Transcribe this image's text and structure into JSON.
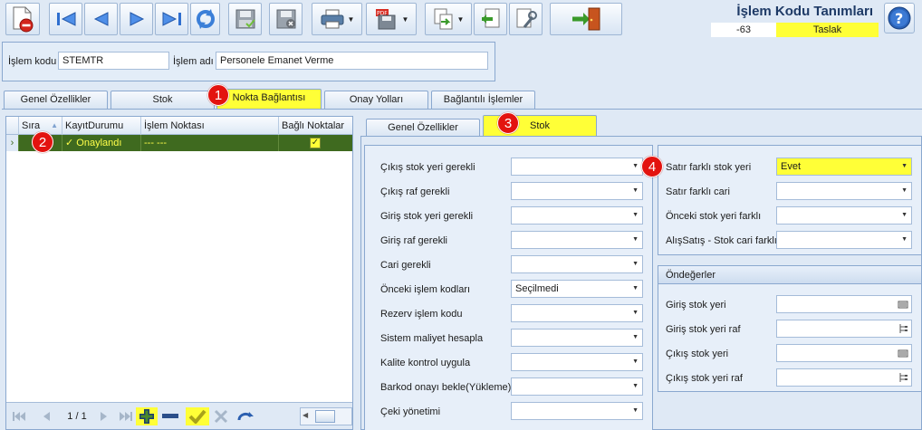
{
  "header": {
    "title": "İşlem Kodu Tanımları",
    "record_no": "-63",
    "status": "Taslak",
    "islem_kodu_label": "İşlem kodu",
    "islem_kodu_value": "STEMTR",
    "islem_adi_label": "İşlem adı",
    "islem_adi_value": "Personele Emanet Verme"
  },
  "toolbar": {
    "icons": [
      "new-delete-icon",
      "first-icon",
      "prev-icon",
      "next-icon",
      "last-icon",
      "refresh-icon",
      "save-icon",
      "cancel-save-icon",
      "print-icon",
      "pdf-save-icon",
      "copy-icon",
      "import-icon",
      "tools-icon",
      "exit-icon",
      "help-icon"
    ]
  },
  "main_tabs": [
    {
      "label": "Genel Özellikler"
    },
    {
      "label": "Stok"
    },
    {
      "label": "Nokta Bağlantısı"
    },
    {
      "label": "Onay Yolları"
    },
    {
      "label": "Bağlantılı İşlemler"
    }
  ],
  "grid": {
    "columns": [
      "Sıra",
      "KayıtDurumu",
      "İşlem Noktası",
      "Bağlı Noktalar"
    ],
    "rows": [
      {
        "sira": "",
        "kayit_durumu": "Onaylandı",
        "islem_noktasi": "--- ---",
        "bagli": true
      }
    ],
    "pager": "1 / 1"
  },
  "sub_tabs": [
    {
      "label": "Genel Özellikler"
    },
    {
      "label": "Stok"
    }
  ],
  "left_fields": [
    {
      "label": "Çıkış stok yeri gerekli",
      "value": ""
    },
    {
      "label": "Çıkış raf gerekli",
      "value": ""
    },
    {
      "label": "Giriş stok yeri gerekli",
      "value": ""
    },
    {
      "label": "Giriş raf gerekli",
      "value": ""
    },
    {
      "label": "Cari gerekli",
      "value": ""
    },
    {
      "label": "Önceki işlem kodları",
      "value": "Seçilmedi"
    },
    {
      "label": "Rezerv işlem kodu",
      "value": ""
    },
    {
      "label": "Sistem maliyet hesapla",
      "value": ""
    },
    {
      "label": "Kalite kontrol uygula",
      "value": ""
    },
    {
      "label": "Barkod onayı bekle(Yükleme)",
      "value": ""
    },
    {
      "label": "Çeki yönetimi",
      "value": ""
    }
  ],
  "right_fields": [
    {
      "label": "Satır farklı stok yeri",
      "value": "Evet"
    },
    {
      "label": "Satır farklı cari",
      "value": ""
    },
    {
      "label": "Önceki stok yeri farklı",
      "value": ""
    },
    {
      "label": "AlışSatış - Stok cari farklı",
      "value": ""
    }
  ],
  "defaults": {
    "title": "Öndeğerler",
    "fields": [
      {
        "label": "Giriş stok yeri",
        "value": "",
        "icon": "barcode-icon"
      },
      {
        "label": "Giriş stok yeri raf",
        "value": "",
        "icon": "tree-icon"
      },
      {
        "label": "Çıkış stok yeri",
        "value": "",
        "icon": "barcode-icon"
      },
      {
        "label": "Çıkış stok yeri raf",
        "value": "",
        "icon": "tree-icon"
      }
    ]
  },
  "callouts": [
    "1",
    "2",
    "3",
    "4"
  ],
  "colors": {
    "highlight": "#ffff37",
    "selected_row": "#3f6a1f",
    "callout": "#e3130f"
  }
}
